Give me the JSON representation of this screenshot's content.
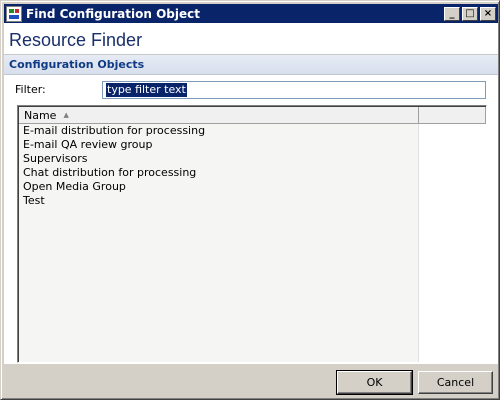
{
  "window": {
    "title": "Find Configuration Object",
    "app_icon": "config-app-icon",
    "controls": {
      "minimize": "_",
      "maximize": "□",
      "close": "×"
    }
  },
  "header": {
    "title": "Resource Finder"
  },
  "section": {
    "title": "Configuration Objects"
  },
  "filter": {
    "label": "Filter:",
    "value": "type filter text"
  },
  "table": {
    "columns": [
      "Name",
      ""
    ],
    "sort_indicator": "▲",
    "rows": [
      "E-mail distribution for processing",
      "E-mail QA review group",
      "Supervisors",
      "Chat distribution for processing",
      "Open Media Group",
      "Test"
    ]
  },
  "buttons": {
    "ok": "OK",
    "cancel": "Cancel"
  },
  "colors": {
    "title_bar": "#0a246a",
    "header_text": "#1a2f6b",
    "section_title": "#0f3a84",
    "selection": "#0a246a"
  }
}
